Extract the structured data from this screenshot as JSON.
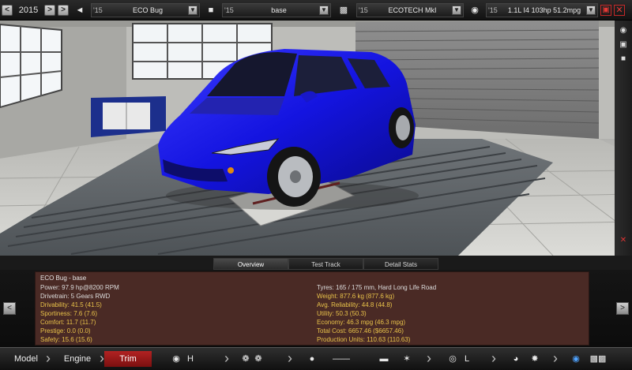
{
  "topbar": {
    "year": "2015",
    "segments": [
      {
        "icon": "car-silhouette-icon",
        "year": "'15",
        "name": "ECO Bug"
      },
      {
        "icon": "car-trim-icon",
        "year": "'15",
        "name": "base"
      },
      {
        "icon": "engine-block-icon",
        "year": "'15",
        "name": "ECOTECH MkI"
      },
      {
        "icon": "engine-variant-icon",
        "year": "'15",
        "name": "1.1L I4 103hp 51.2mpg"
      }
    ]
  },
  "tabs": [
    "Overview",
    "Test Track",
    "Detail Stats"
  ],
  "stats": {
    "title": "ECO Bug - base",
    "left": [
      {
        "text": "Power: 97.9 hp@8200 RPM",
        "color": "white"
      },
      {
        "text": "Drivetrain: 5 Gears RWD",
        "color": "white"
      },
      {
        "text": "Drivability: 41.5 (41.5)",
        "color": "yellow"
      },
      {
        "text": "Sportiness: 7.6 (7.6)",
        "color": "yellow"
      },
      {
        "text": "Comfort: 11.7 (11.7)",
        "color": "yellow"
      },
      {
        "text": "Prestige: 0.0 (0.0)",
        "color": "yellow"
      },
      {
        "text": "Safety: 15.6 (15.6)",
        "color": "yellow"
      }
    ],
    "right": [
      {
        "text": "Tyres: 165 / 175 mm, Hard Long Life Road",
        "color": "white"
      },
      {
        "text": "Weight: 877.6 kg (877.6 kg)",
        "color": "yellow"
      },
      {
        "text": "Avg. Reliability: 44.8 (44.8)",
        "color": "yellow"
      },
      {
        "text": "Utility: 50.3 (50.3)",
        "color": "yellow"
      },
      {
        "text": "Economy: 46.3 mpg (46.3 mpg)",
        "color": "yellow"
      },
      {
        "text": "Total Cost: 6657.46 ($6657.46)",
        "color": "yellow"
      },
      {
        "text": "Production Units: 110.63 (110.63)",
        "color": "yellow"
      }
    ]
  },
  "stages": [
    "Model",
    "Engine",
    "Trim"
  ],
  "colors": {
    "accent_red": "#b22222",
    "car_blue": "#1a1ae6",
    "panel_bg": "#4a2a25",
    "stat_yellow": "#e8c24a"
  }
}
